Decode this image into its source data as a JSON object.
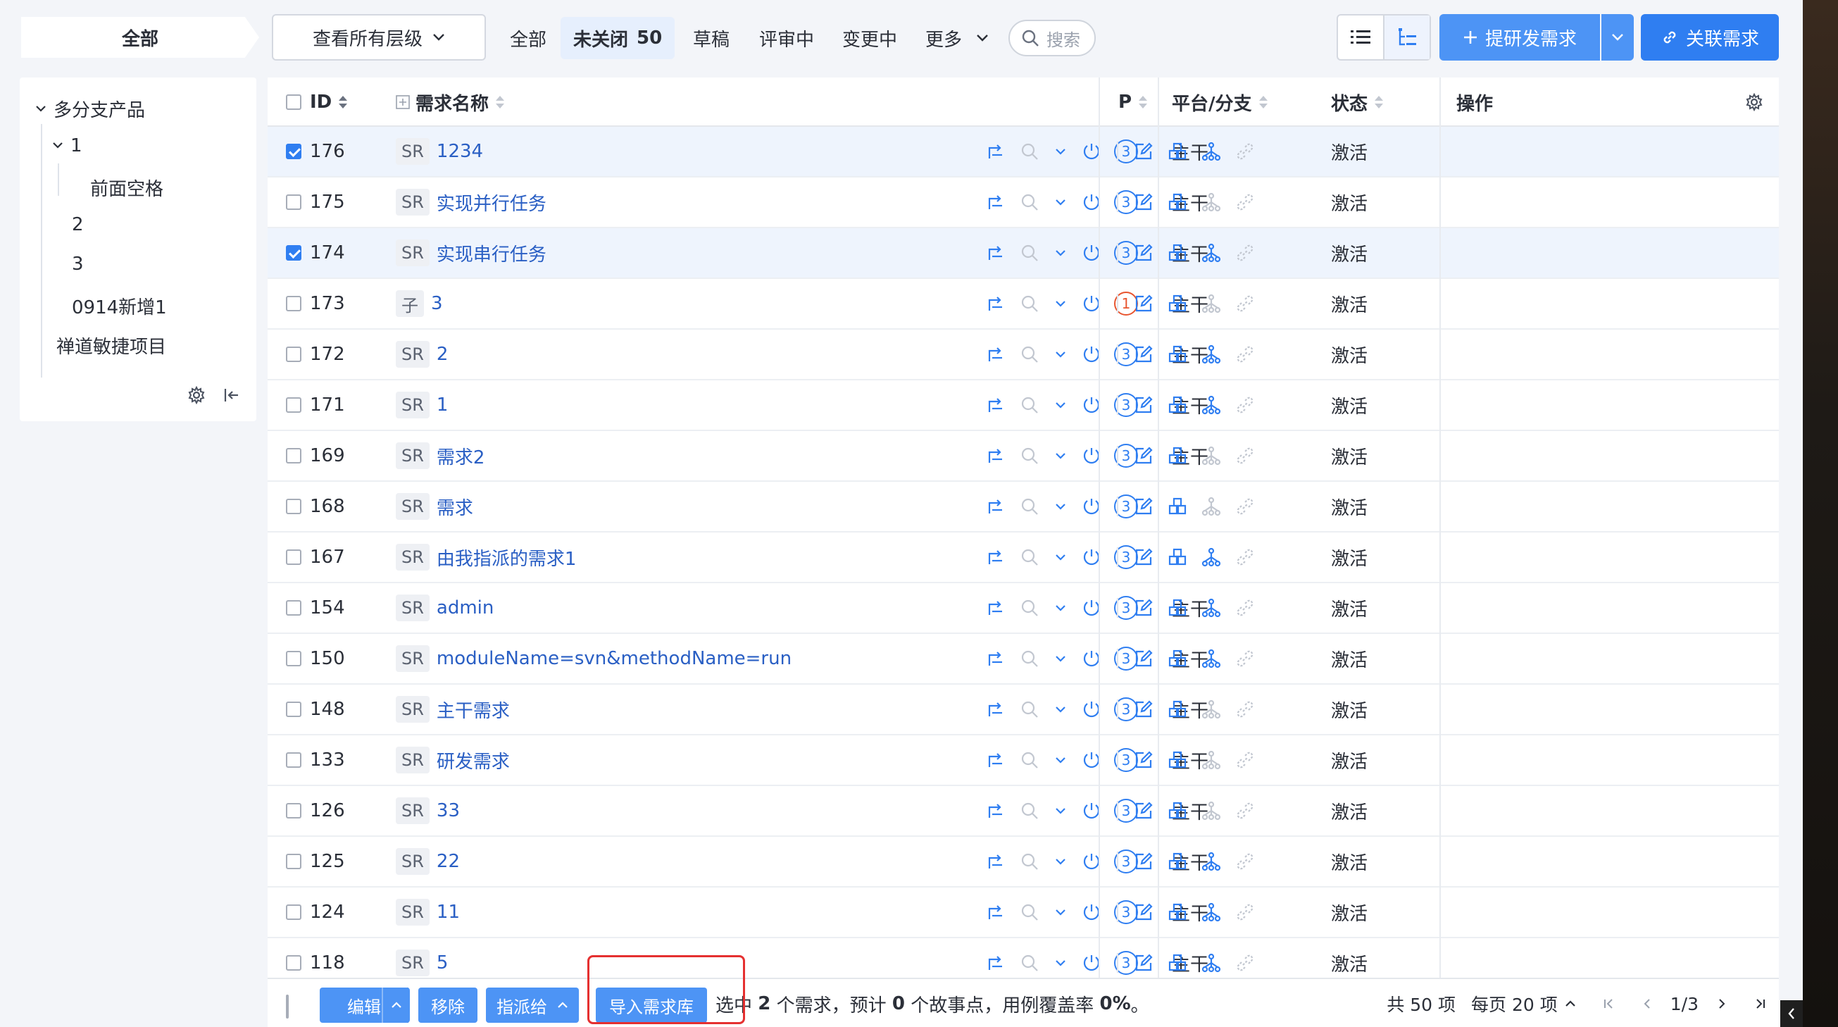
{
  "crumb": "全部",
  "level_select": "查看所有层级",
  "tabs": [
    {
      "label": "全部",
      "active": false,
      "count": ""
    },
    {
      "label": "未关闭",
      "active": true,
      "count": "50"
    },
    {
      "label": "草稿",
      "active": false,
      "count": ""
    },
    {
      "label": "评审中",
      "active": false,
      "count": ""
    },
    {
      "label": "变更中",
      "active": false,
      "count": ""
    },
    {
      "label": "更多",
      "active": false,
      "count": ""
    }
  ],
  "search_label": "搜索",
  "create_button": "提研发需求",
  "link_button": "关联需求",
  "sidebar": {
    "root": "多分支产品",
    "items": [
      {
        "label": "1"
      },
      {
        "label": "前面空格"
      },
      {
        "label": "2"
      },
      {
        "label": "3"
      },
      {
        "label": "0914新增1"
      }
    ],
    "project": "禅道敏捷项目"
  },
  "columns": {
    "id": "ID",
    "name": "需求名称",
    "pri": "P",
    "branch": "平台/分支",
    "status": "状态",
    "actions": "操作"
  },
  "rows": [
    {
      "id": "176",
      "type": "SR",
      "name": "1234",
      "pri": "3",
      "branch": "主干",
      "status": "激活",
      "checked": true,
      "sub": true
    },
    {
      "id": "175",
      "type": "SR",
      "name": "实现并行任务",
      "pri": "3",
      "branch": "主干",
      "status": "激活",
      "checked": false,
      "sub": false
    },
    {
      "id": "174",
      "type": "SR",
      "name": "实现串行任务",
      "pri": "3",
      "branch": "主干",
      "status": "激活",
      "checked": true,
      "sub": true
    },
    {
      "id": "173",
      "type": "子",
      "name": "3",
      "pri": "1",
      "branch": "主干",
      "status": "激活",
      "checked": false,
      "sub": false
    },
    {
      "id": "172",
      "type": "SR",
      "name": "2",
      "pri": "3",
      "branch": "主干",
      "status": "激活",
      "checked": false,
      "sub": true
    },
    {
      "id": "171",
      "type": "SR",
      "name": "1",
      "pri": "3",
      "branch": "主干",
      "status": "激活",
      "checked": false,
      "sub": true
    },
    {
      "id": "169",
      "type": "SR",
      "name": "需求2",
      "pri": "3",
      "branch": "主干",
      "status": "激活",
      "checked": false,
      "sub": false
    },
    {
      "id": "168",
      "type": "SR",
      "name": "需求",
      "pri": "3",
      "branch": "",
      "status": "激活",
      "checked": false,
      "sub": false
    },
    {
      "id": "167",
      "type": "SR",
      "name": "由我指派的需求1",
      "pri": "3",
      "branch": "",
      "status": "激活",
      "checked": false,
      "sub": true
    },
    {
      "id": "154",
      "type": "SR",
      "name": "admin",
      "pri": "3",
      "branch": "主干",
      "status": "激活",
      "checked": false,
      "sub": true
    },
    {
      "id": "150",
      "type": "SR",
      "name": "moduleName=svn&methodName=run",
      "pri": "3",
      "branch": "主干",
      "status": "激活",
      "checked": false,
      "sub": true
    },
    {
      "id": "148",
      "type": "SR",
      "name": "主干需求",
      "pri": "3",
      "branch": "主干",
      "status": "激活",
      "checked": false,
      "sub": false
    },
    {
      "id": "133",
      "type": "SR",
      "name": "研发需求",
      "pri": "3",
      "branch": "主干",
      "status": "激活",
      "checked": false,
      "sub": false
    },
    {
      "id": "126",
      "type": "SR",
      "name": "33",
      "pri": "3",
      "branch": "主干",
      "status": "激活",
      "checked": false,
      "sub": false
    },
    {
      "id": "125",
      "type": "SR",
      "name": "22",
      "pri": "3",
      "branch": "主干",
      "status": "激活",
      "checked": false,
      "sub": true
    },
    {
      "id": "124",
      "type": "SR",
      "name": "11",
      "pri": "3",
      "branch": "主干",
      "status": "激活",
      "checked": false,
      "sub": true
    },
    {
      "id": "118",
      "type": "SR",
      "name": "5",
      "pri": "3",
      "branch": "主干",
      "status": "激活",
      "checked": false,
      "sub": true
    }
  ],
  "footer": {
    "edit": "编辑",
    "remove": "移除",
    "assign": "指派给",
    "import": "导入需求库",
    "summary_prefix": "选中 ",
    "selected_count": "2",
    "summary_mid1": " 个需求，预计 ",
    "estimate": "0",
    "summary_mid2": " 个故事点，用例覆盖率 ",
    "coverage": "0%",
    "summary_suffix": "。",
    "total": "共 50 项",
    "per_page": "每页 20 项",
    "page": "1/3"
  },
  "colors": {
    "primary": "#2f7ef1",
    "button": "#4d94f5",
    "link_text": "#2a5fc4",
    "highlight": "#e53030"
  }
}
